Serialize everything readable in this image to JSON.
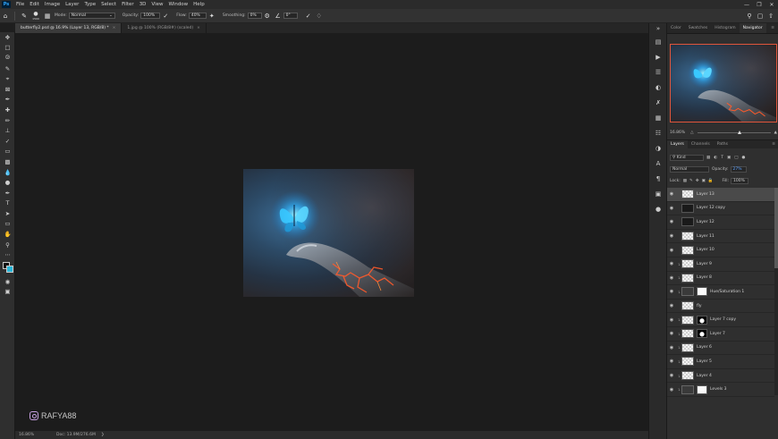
{
  "menu": {
    "app_badge": "Ps",
    "items": [
      "File",
      "Edit",
      "Image",
      "Layer",
      "Type",
      "Select",
      "Filter",
      "3D",
      "View",
      "Window",
      "Help"
    ]
  },
  "options": {
    "brush_size": "1500",
    "mode_label": "Mode:",
    "mode_value": "Normal",
    "opacity_label": "Opacity:",
    "opacity_value": "100%",
    "flow_label": "Flow:",
    "flow_value": "40%",
    "smoothing_label": "Smoothing:",
    "smoothing_value": "0%",
    "angle_value": "0°"
  },
  "tabs": [
    {
      "label": "butterfly2.psd @ 16.9% (Layer 13, RGB/8) *"
    },
    {
      "label": "1.jpg @ 100% (RGB/8#) (scaled)"
    }
  ],
  "status": {
    "zoom": "16.86%",
    "doc": "Doc: 13.9M/276.6M"
  },
  "watermark": {
    "handle": "RAFYA88"
  },
  "panels": {
    "top_tabs": [
      "Color",
      "Swatches",
      "Histogram",
      "Navigator"
    ],
    "nav_zoom": "16.86%",
    "layer_tabs": [
      "Layers",
      "Channels",
      "Paths"
    ],
    "kind_label": "Kind",
    "blend_mode": "Normal",
    "opacity_label": "Opacity:",
    "opacity_value": "27%",
    "lock_label": "Lock:",
    "fill_label": "Fill:",
    "fill_value": "100%"
  },
  "layers": [
    {
      "name": "Layer 13",
      "thumb": "checker",
      "mask": "",
      "selected": true,
      "clipped": false
    },
    {
      "name": "Layer 12 copy",
      "thumb": "dark",
      "mask": "",
      "selected": false,
      "clipped": false
    },
    {
      "name": "Layer 12",
      "thumb": "dark",
      "mask": "",
      "selected": false,
      "clipped": false
    },
    {
      "name": "Layer 11",
      "thumb": "checker",
      "mask": "",
      "selected": false,
      "clipped": false
    },
    {
      "name": "Layer 10",
      "thumb": "checker",
      "mask": "",
      "selected": false,
      "clipped": false
    },
    {
      "name": "Layer 9",
      "thumb": "checker",
      "mask": "",
      "selected": false,
      "clipped": true
    },
    {
      "name": "Layer 8",
      "thumb": "checker",
      "mask": "",
      "selected": false,
      "clipped": true
    },
    {
      "name": "Hue/Saturation 1",
      "thumb": "adj",
      "mask": "white",
      "selected": false,
      "clipped": true
    },
    {
      "name": "fly",
      "thumb": "checker",
      "mask": "",
      "selected": false,
      "clipped": false
    },
    {
      "name": "Layer 7 copy",
      "thumb": "checker",
      "mask": "black",
      "selected": false,
      "clipped": true
    },
    {
      "name": "Layer 7",
      "thumb": "checker",
      "mask": "black",
      "selected": false,
      "clipped": true
    },
    {
      "name": "Layer 6",
      "thumb": "checker",
      "mask": "",
      "selected": false,
      "clipped": true
    },
    {
      "name": "Layer 5",
      "thumb": "checker",
      "mask": "",
      "selected": false,
      "clipped": true
    },
    {
      "name": "Layer 4",
      "thumb": "checker",
      "mask": "",
      "selected": false,
      "clipped": true
    },
    {
      "name": "Levels 3",
      "thumb": "adj",
      "mask": "white",
      "selected": false,
      "clipped": true
    }
  ],
  "colors": {
    "accent": "#31a8ff",
    "foreground": "#111111",
    "background": "#29b6d8",
    "nav_border": "#e0553b"
  }
}
